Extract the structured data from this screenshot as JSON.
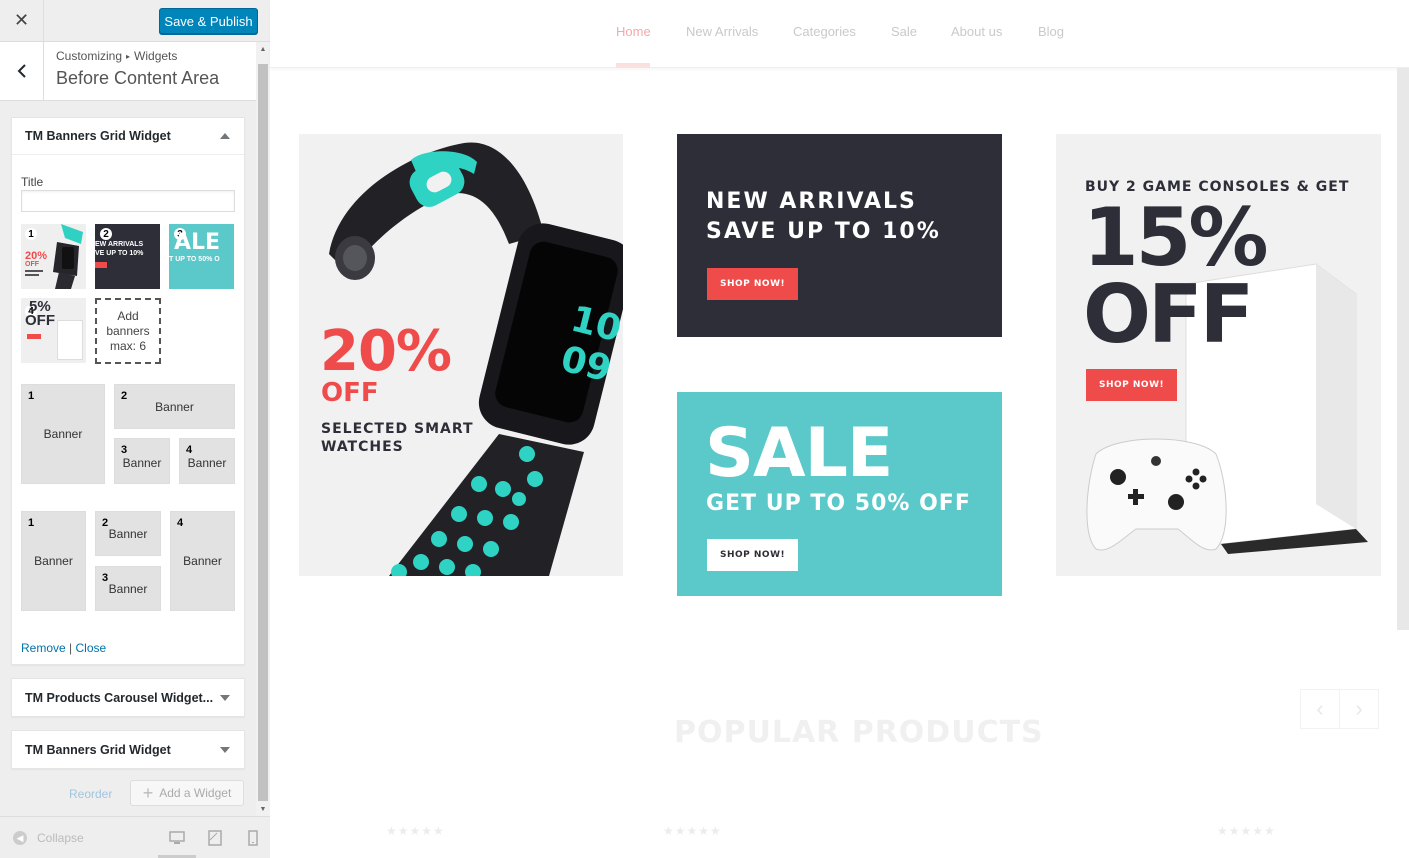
{
  "sidebar": {
    "close_icon": "close-icon",
    "save_label": "Save & Publish",
    "breadcrumb": {
      "root": "Customizing",
      "separator": "▸",
      "current": "Widgets"
    },
    "section_title": "Before Content Area",
    "widgets": [
      {
        "title": "TM Banners Grid Widget",
        "expanded": true
      },
      {
        "title": "TM Products Carousel Widget...",
        "expanded": false
      },
      {
        "title": "TM Banners Grid Widget",
        "expanded": false
      }
    ],
    "title_label": "Title",
    "title_value": "",
    "thumbs": [
      {
        "num": "1",
        "big": "20%",
        "sub": "OFF"
      },
      {
        "num": "2",
        "line1": "EW ARRIVALS",
        "line2": "VE UP TO 10%"
      },
      {
        "num": "3",
        "big": "ALE",
        "sub": "T UP TO 50% O"
      },
      {
        "num": "4",
        "big": "5%",
        "sub": "OFF"
      }
    ],
    "add_banners": "Add\nbanners\nmax: 6",
    "layout1": [
      {
        "n": "1",
        "label": "Banner"
      },
      {
        "n": "2",
        "label": "Banner"
      },
      {
        "n": "3",
        "label": "Banner"
      },
      {
        "n": "4",
        "label": "Banner"
      }
    ],
    "layout2": [
      {
        "n": "1",
        "label": "Banner"
      },
      {
        "n": "2",
        "label": "Banner"
      },
      {
        "n": "3",
        "label": "Banner"
      },
      {
        "n": "4",
        "label": "Banner"
      }
    ],
    "remove": "Remove",
    "pipe": "|",
    "close": "Close",
    "reorder": "Reorder",
    "add_widget": "Add a Widget",
    "collapse": "Collapse"
  },
  "preview": {
    "nav": [
      "Home",
      "New Arrivals",
      "Categories",
      "Sale",
      "About us",
      "Blog"
    ],
    "active_nav": "Home",
    "banners": {
      "watch": {
        "big": "20%",
        "off": "OFF",
        "line1": "SELECTED SMART",
        "line2": "WATCHES",
        "watch_time_1": "10",
        "watch_time_2": "09"
      },
      "arrivals": {
        "line1": "NEW ARRIVALS",
        "line2": "SAVE UP TO 10%",
        "button": "SHOP NOW!"
      },
      "sale": {
        "big": "SALE",
        "line": "GET UP TO 50% OFF",
        "button": "SHOP NOW!"
      },
      "console": {
        "line": "BUY 2 GAME CONSOLES & GET",
        "big1": "15%",
        "big2": "OFF",
        "button": "SHOP NOW!"
      }
    },
    "popular_title": "POPULAR PRODUCTS",
    "prev_icon": "‹",
    "next_icon": "›",
    "stars": "★★★★★"
  },
  "colors": {
    "accent": "#0085ba",
    "red": "#ef4b4b",
    "teal": "#5bc8c9",
    "dark": "#2e2e38",
    "link": "#0073aa"
  }
}
